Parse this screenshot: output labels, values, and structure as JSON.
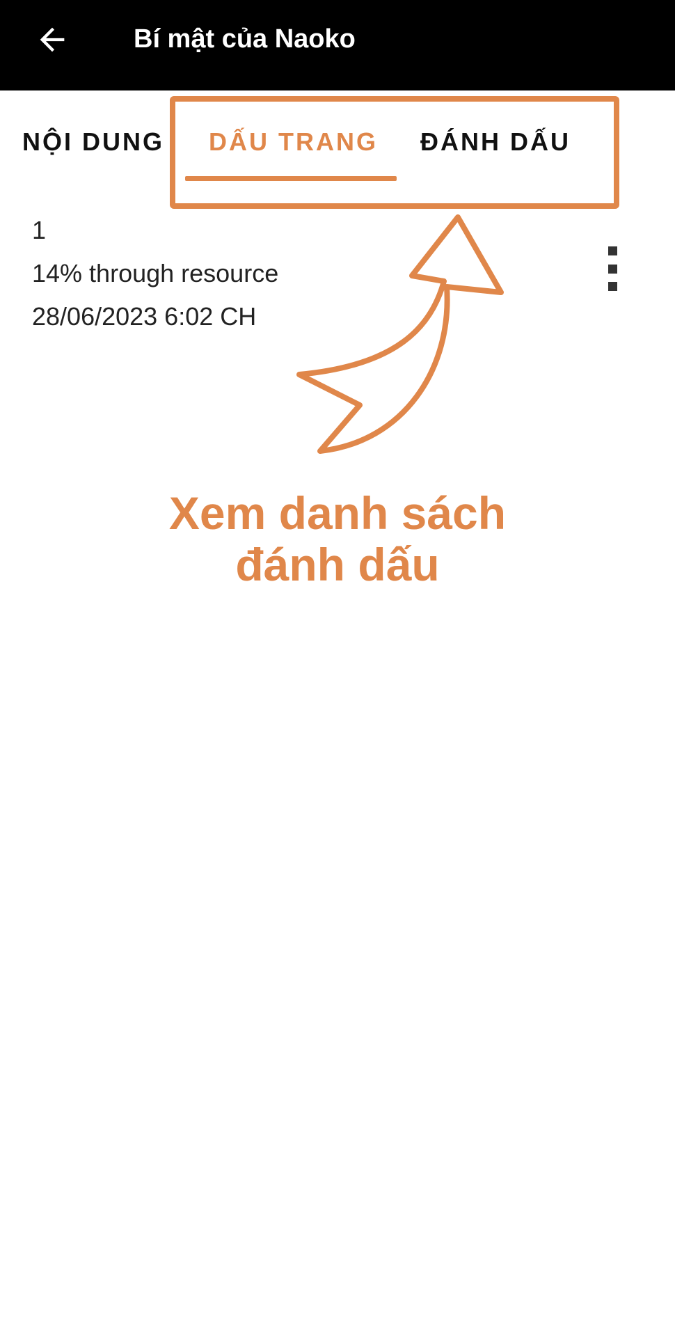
{
  "appbar": {
    "title": "Bí mật của Naoko",
    "back_icon": "arrow-left-icon"
  },
  "tabs": [
    {
      "label": "NỘI DUNG",
      "selected": false
    },
    {
      "label": "DẤU TRANG",
      "selected": true
    },
    {
      "label": "ĐÁNH DẤU",
      "selected": false
    }
  ],
  "bookmark": {
    "number": "1",
    "progress": "14% through resource",
    "timestamp": "28/06/2023 6:02 CH",
    "menu_icon": "more-vertical-icon"
  },
  "annotation": {
    "caption_line1": "Xem danh sách",
    "caption_line2": "đánh dấu",
    "color": "#E0874A",
    "arrow_icon": "curved-arrow-up-icon"
  },
  "colors": {
    "accent": "#E0874A",
    "appbar": "#000000",
    "text": "#222222"
  }
}
